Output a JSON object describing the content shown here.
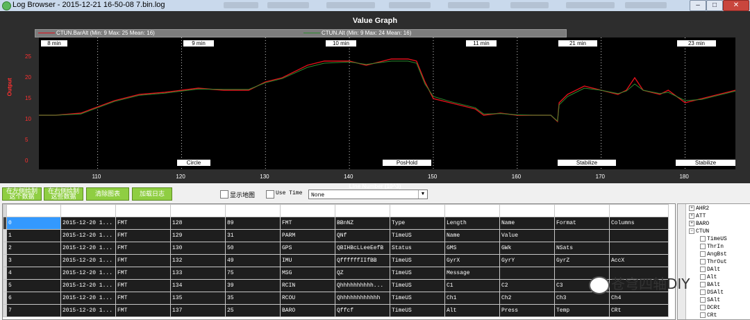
{
  "window": {
    "title": "Log Browser - 2015-12-21 16-50-08 7.bin.log",
    "controls": [
      "–",
      "□",
      "✕"
    ]
  },
  "graph": {
    "title": "Value Graph",
    "ylabel": "Output",
    "xlabel": "Line Number (10^3)",
    "legend": [
      {
        "label": "CTUN.BarAlt (Min: 9 Max: 25 Mean: 16)",
        "color": "#e0101a"
      },
      {
        "label": "CTUN.Alt (Min: 9 Max: 24 Mean: 16)",
        "color": "#2e8b2e"
      }
    ],
    "time_labels": [
      "8 min",
      "9 min",
      "10 min",
      "11 min",
      "21 min",
      "23 min"
    ],
    "mode_labels": [
      "Circle",
      "PosHold",
      "Stabilize",
      "Stabilize"
    ]
  },
  "chart_data": {
    "type": "line",
    "title": "Value Graph",
    "xlabel": "Line Number (10^3)",
    "ylabel": "Output",
    "xlim": [
      103,
      186
    ],
    "ylim": [
      0,
      27
    ],
    "xticks": [
      110,
      120,
      130,
      140,
      150,
      160,
      170,
      180
    ],
    "yticks": [
      0,
      5,
      10,
      15,
      20,
      25
    ],
    "grid": true,
    "series": [
      {
        "name": "CTUN.BarAlt (Min: 9 Max: 25 Mean: 16)",
        "color": "#e0101a",
        "x": [
          103,
          105,
          108,
          110,
          112,
          115,
          118,
          120,
          122,
          125,
          128,
          130,
          132,
          135,
          137,
          140,
          142,
          145,
          147,
          148,
          149,
          150,
          152,
          155,
          156,
          158,
          160,
          162,
          164,
          164.8,
          165,
          166,
          167,
          168,
          170,
          172,
          173,
          174,
          175,
          177,
          178,
          180,
          182,
          184,
          186
        ],
        "y": [
          11,
          11,
          11.5,
          13,
          14.5,
          16,
          16.5,
          17,
          17.5,
          17,
          17,
          19,
          20,
          23,
          24,
          24,
          23,
          24.5,
          24.5,
          24,
          19,
          15,
          14,
          12.5,
          11,
          11.5,
          11,
          11,
          11,
          9.5,
          14,
          16,
          17,
          18,
          17,
          16,
          17,
          20,
          17,
          16,
          17,
          14,
          15,
          16,
          17
        ]
      },
      {
        "name": "CTUN.Alt (Min: 9 Max: 24 Mean: 16)",
        "color": "#2e8b2e",
        "x": [
          103,
          105,
          108,
          110,
          112,
          115,
          118,
          120,
          122,
          125,
          128,
          130,
          132,
          135,
          137,
          140,
          142,
          145,
          147,
          148,
          149,
          150,
          152,
          155,
          156,
          158,
          160,
          162,
          164,
          164.8,
          165,
          166,
          167,
          168,
          170,
          172,
          173,
          174,
          175,
          177,
          178,
          180,
          182,
          184,
          186
        ],
        "y": [
          11,
          11,
          11.3,
          12.8,
          14.3,
          15.8,
          16.3,
          16.8,
          17.3,
          17.2,
          17.2,
          18.8,
          19.8,
          22.5,
          23.5,
          23.8,
          23.2,
          24,
          24,
          23.5,
          18.5,
          15.5,
          14.3,
          12.8,
          11.3,
          11.4,
          11.1,
          11,
          11,
          9.6,
          13.5,
          15.5,
          16.5,
          17.5,
          17,
          16.2,
          16.8,
          18.5,
          17,
          16.2,
          16.5,
          14.5,
          14.8,
          15.8,
          16.8
        ]
      }
    ]
  },
  "toolbar": {
    "btn_left_graph": "在左侧绘制 这个数据",
    "btn_right_graph": "在右侧绘制 这些数据",
    "btn_clear": "清除图表",
    "btn_load_log": "加载日志",
    "show_map_label": "显示地图",
    "use_time_label": "Use Time",
    "select_value": "None"
  },
  "table": {
    "columns": [
      "",
      "",
      "",
      "",
      "",
      "",
      "",
      "",
      "",
      "",
      "",
      ""
    ],
    "rows": [
      [
        "0",
        "2015-12-20 1...",
        "FMT",
        "128",
        "89",
        "FMT",
        "BBnNZ",
        "Type",
        "Length",
        "Name",
        "Format",
        "Columns"
      ],
      [
        "1",
        "2015-12-20 1...",
        "FMT",
        "129",
        "31",
        "PARM",
        "QNf",
        "TimeUS",
        "Name",
        "Value",
        "",
        ""
      ],
      [
        "2",
        "2015-12-20 1...",
        "FMT",
        "130",
        "50",
        "GPS",
        "QBIHBcLLeeEefB",
        "Status",
        "GMS",
        "GWk",
        "NSats",
        ""
      ],
      [
        "3",
        "2015-12-20 1...",
        "FMT",
        "132",
        "49",
        "IMU",
        "QffffffIIfBB",
        "TimeUS",
        "GyrX",
        "GyrY",
        "GyrZ",
        "AccX"
      ],
      [
        "4",
        "2015-12-20 1...",
        "FMT",
        "133",
        "75",
        "MSG",
        "QZ",
        "TimeUS",
        "Message",
        "",
        "",
        ""
      ],
      [
        "5",
        "2015-12-20 1...",
        "FMT",
        "134",
        "39",
        "RCIN",
        "Qhhhhhhhhhh...",
        "TimeUS",
        "C1",
        "C2",
        "C3",
        ""
      ],
      [
        "6",
        "2015-12-20 1...",
        "FMT",
        "135",
        "35",
        "RCOU",
        "Qhhhhhhhhhhhh",
        "TimeUS",
        "Ch1",
        "Ch2",
        "Ch3",
        "Ch4"
      ],
      [
        "7",
        "2015-12-20 1...",
        "FMT",
        "137",
        "25",
        "BARO",
        "Qffcf",
        "TimeUS",
        "Alt",
        "Press",
        "Temp",
        "CRt"
      ]
    ]
  },
  "tree": {
    "items": [
      "AHR2",
      "ATT",
      "BARO",
      "CTUN",
      "TimeUS",
      "ThrIn",
      "AngBst",
      "ThrOut",
      "DAlt",
      "Alt",
      "BAlt",
      "DSAlt",
      "SAlt",
      "DCRt",
      "CRt"
    ]
  },
  "watermark": "苍穹四轴DIY"
}
